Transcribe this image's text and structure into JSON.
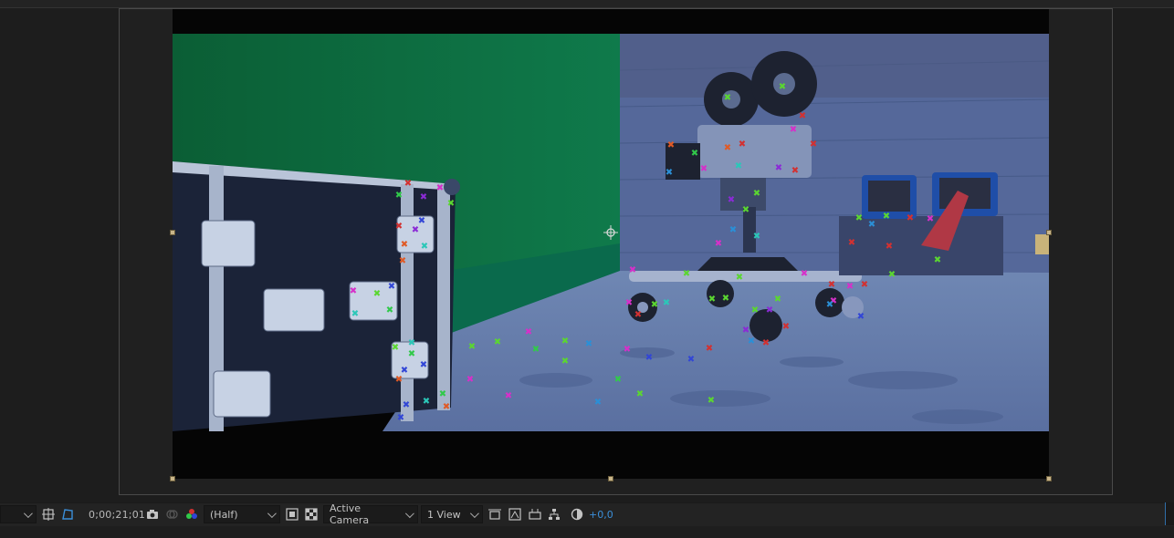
{
  "viewer": {
    "magnification_control": "",
    "timecode": "0;00;21;01",
    "resolution": "(Half)",
    "view": "Active Camera",
    "layout": "1 View",
    "exposure": "+0,0"
  },
  "colors": {
    "accent_blue": "#3b8fd9",
    "panel_bg": "#1d1d1d",
    "handle": "#c9b58a",
    "greenscreen": "#0c6b3d"
  },
  "icons": [
    "chevron-down-icon",
    "grid-guides-icon",
    "mask-path-icon",
    "camera-snapshot-icon",
    "show-snapshot-icon",
    "color-channels-icon",
    "fast-preview-icon",
    "transparency-grid-icon",
    "region-of-interest-icon",
    "3d-draft-icon",
    "flowchart-icon",
    "reset-exposure-icon",
    "anchor-point-icon"
  ]
}
